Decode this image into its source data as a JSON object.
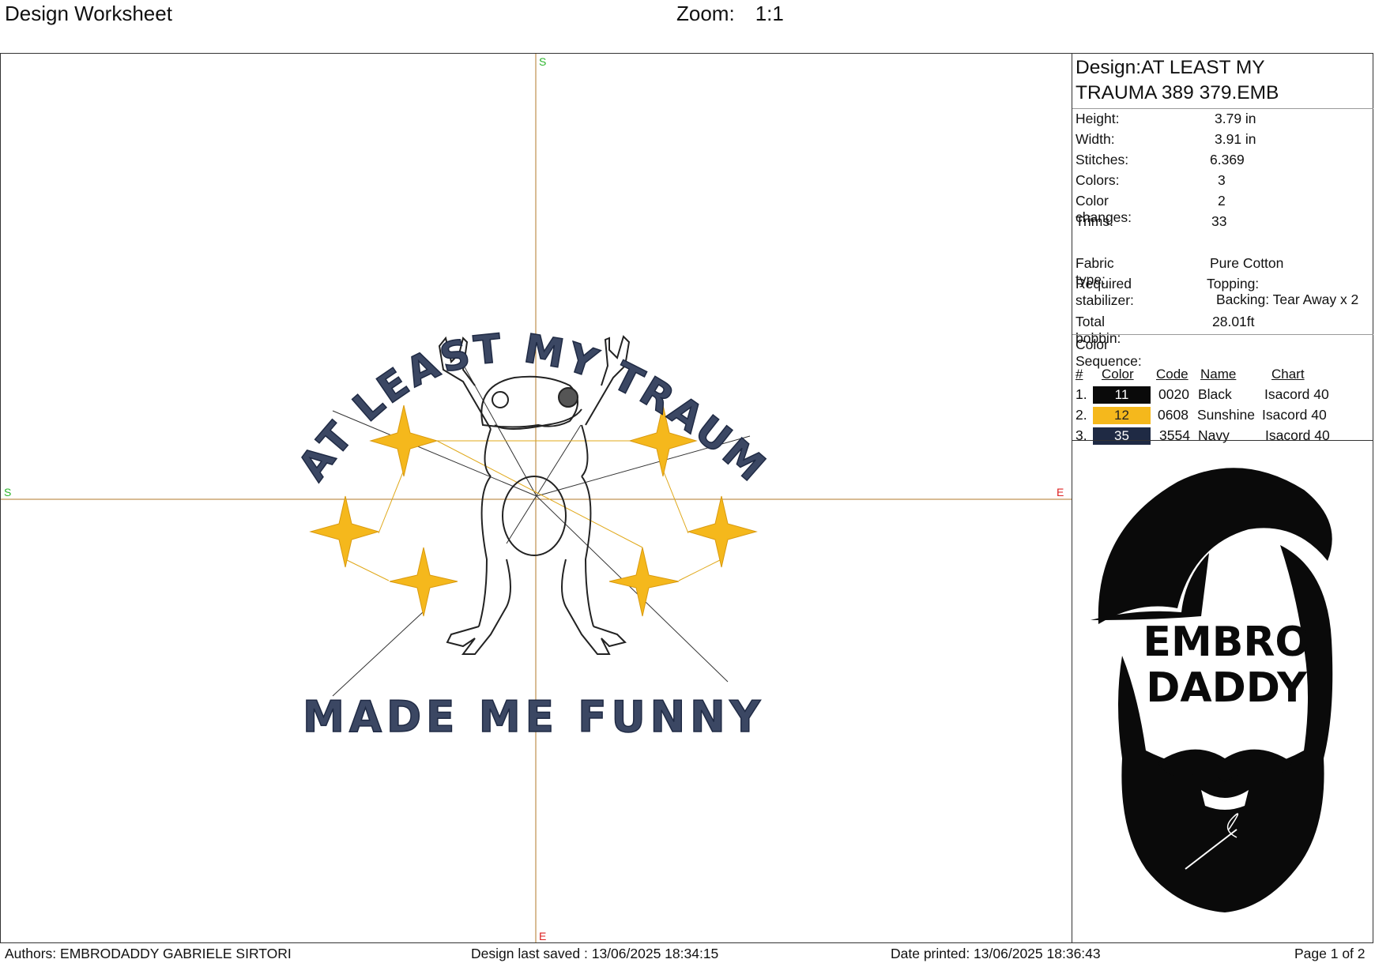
{
  "header": {
    "title": "Design Worksheet",
    "zoom_label": "Zoom:",
    "zoom_value": "1:1"
  },
  "design": {
    "name": "Design:AT LEAST MY TRAUMA 389 379.EMB",
    "name_line1": "Design:AT LEAST MY",
    "name_line2": "TRAUMA 389 379.EMB",
    "stats": [
      {
        "label": "Height:",
        "value": "3.79 in"
      },
      {
        "label": "Width:",
        "value": "3.91 in"
      },
      {
        "label": "Stitches:",
        "value": "6.369"
      },
      {
        "label": "Colors:",
        "value": "3"
      },
      {
        "label": "Color changes:",
        "value": "2"
      },
      {
        "label": "Trims:",
        "value": "33"
      }
    ],
    "fabric_label": "Fabric type:",
    "fabric_value": "Pure Cotton",
    "stabilizer_label": "Required stabilizer:",
    "topping": "Topping:",
    "backing": "Backing: Tear Away x 2",
    "bobbin_label": "Total bobbin:",
    "bobbin_value": "28.01ft"
  },
  "color_sequence": {
    "title": "Color Sequence:",
    "headers": {
      "num": "#",
      "color": "Color",
      "code": "Code",
      "name": "Name",
      "chart": "Chart"
    },
    "rows": [
      {
        "num": "1.",
        "swatch": "11",
        "hex": "#0a0a0a",
        "code": "0020",
        "name": "Black",
        "chart": "Isacord 40"
      },
      {
        "num": "2.",
        "swatch": "12",
        "hex": "#f5b81c",
        "code": "0608",
        "name": "Sunshine",
        "chart": "Isacord 40"
      },
      {
        "num": "3.",
        "swatch": "35",
        "hex": "#1f2a44",
        "code": "3554",
        "name": "Navy",
        "chart": "Isacord 40"
      }
    ]
  },
  "canvas": {
    "axis_start": "S",
    "axis_end": "E",
    "text_top": "AT LEAST MY TRAUMA",
    "text_bottom": "MADE ME FUNNY",
    "navy": "#2e3a55",
    "gold": "#f5b81c",
    "axis_color": "#b07a2a"
  },
  "logo": {
    "line1": "EMBRO",
    "line2": "DADDY",
    "color": "#0a0a0a"
  },
  "footer": {
    "authors": "Authors: EMBRODADDY GABRIELE SIRTORI",
    "saved": "Design last saved : 13/06/2025 18:34:15",
    "printed": "Date printed: 13/06/2025 18:36:43",
    "page": "Page 1 of 2"
  }
}
